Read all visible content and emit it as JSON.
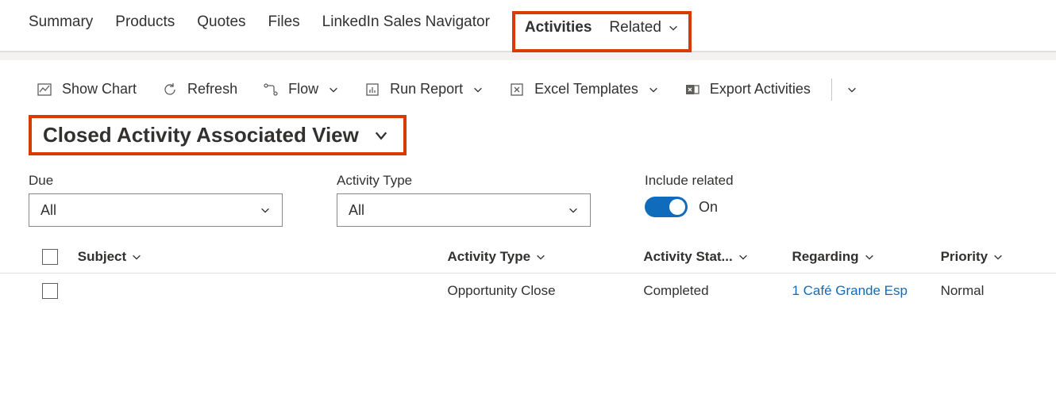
{
  "tabs": {
    "summary": "Summary",
    "products": "Products",
    "quotes": "Quotes",
    "files": "Files",
    "linkedin": "LinkedIn Sales Navigator",
    "activities": "Activities",
    "related": "Related"
  },
  "toolbar": {
    "show_chart": "Show Chart",
    "refresh": "Refresh",
    "flow": "Flow",
    "run_report": "Run Report",
    "excel_templates": "Excel Templates",
    "export_activities": "Export Activities"
  },
  "view": {
    "title": "Closed Activity Associated View"
  },
  "filters": {
    "due_label": "Due",
    "due_value": "All",
    "type_label": "Activity Type",
    "type_value": "All",
    "include_label": "Include related",
    "include_value": "On"
  },
  "grid": {
    "headers": {
      "subject": "Subject",
      "activity_type": "Activity Type",
      "activity_status": "Activity Stat...",
      "regarding": "Regarding",
      "priority": "Priority"
    },
    "rows": [
      {
        "subject": "",
        "activity_type": "Opportunity Close",
        "activity_status": "Completed",
        "regarding": "1 Café Grande Esp",
        "priority": "Normal"
      }
    ]
  }
}
